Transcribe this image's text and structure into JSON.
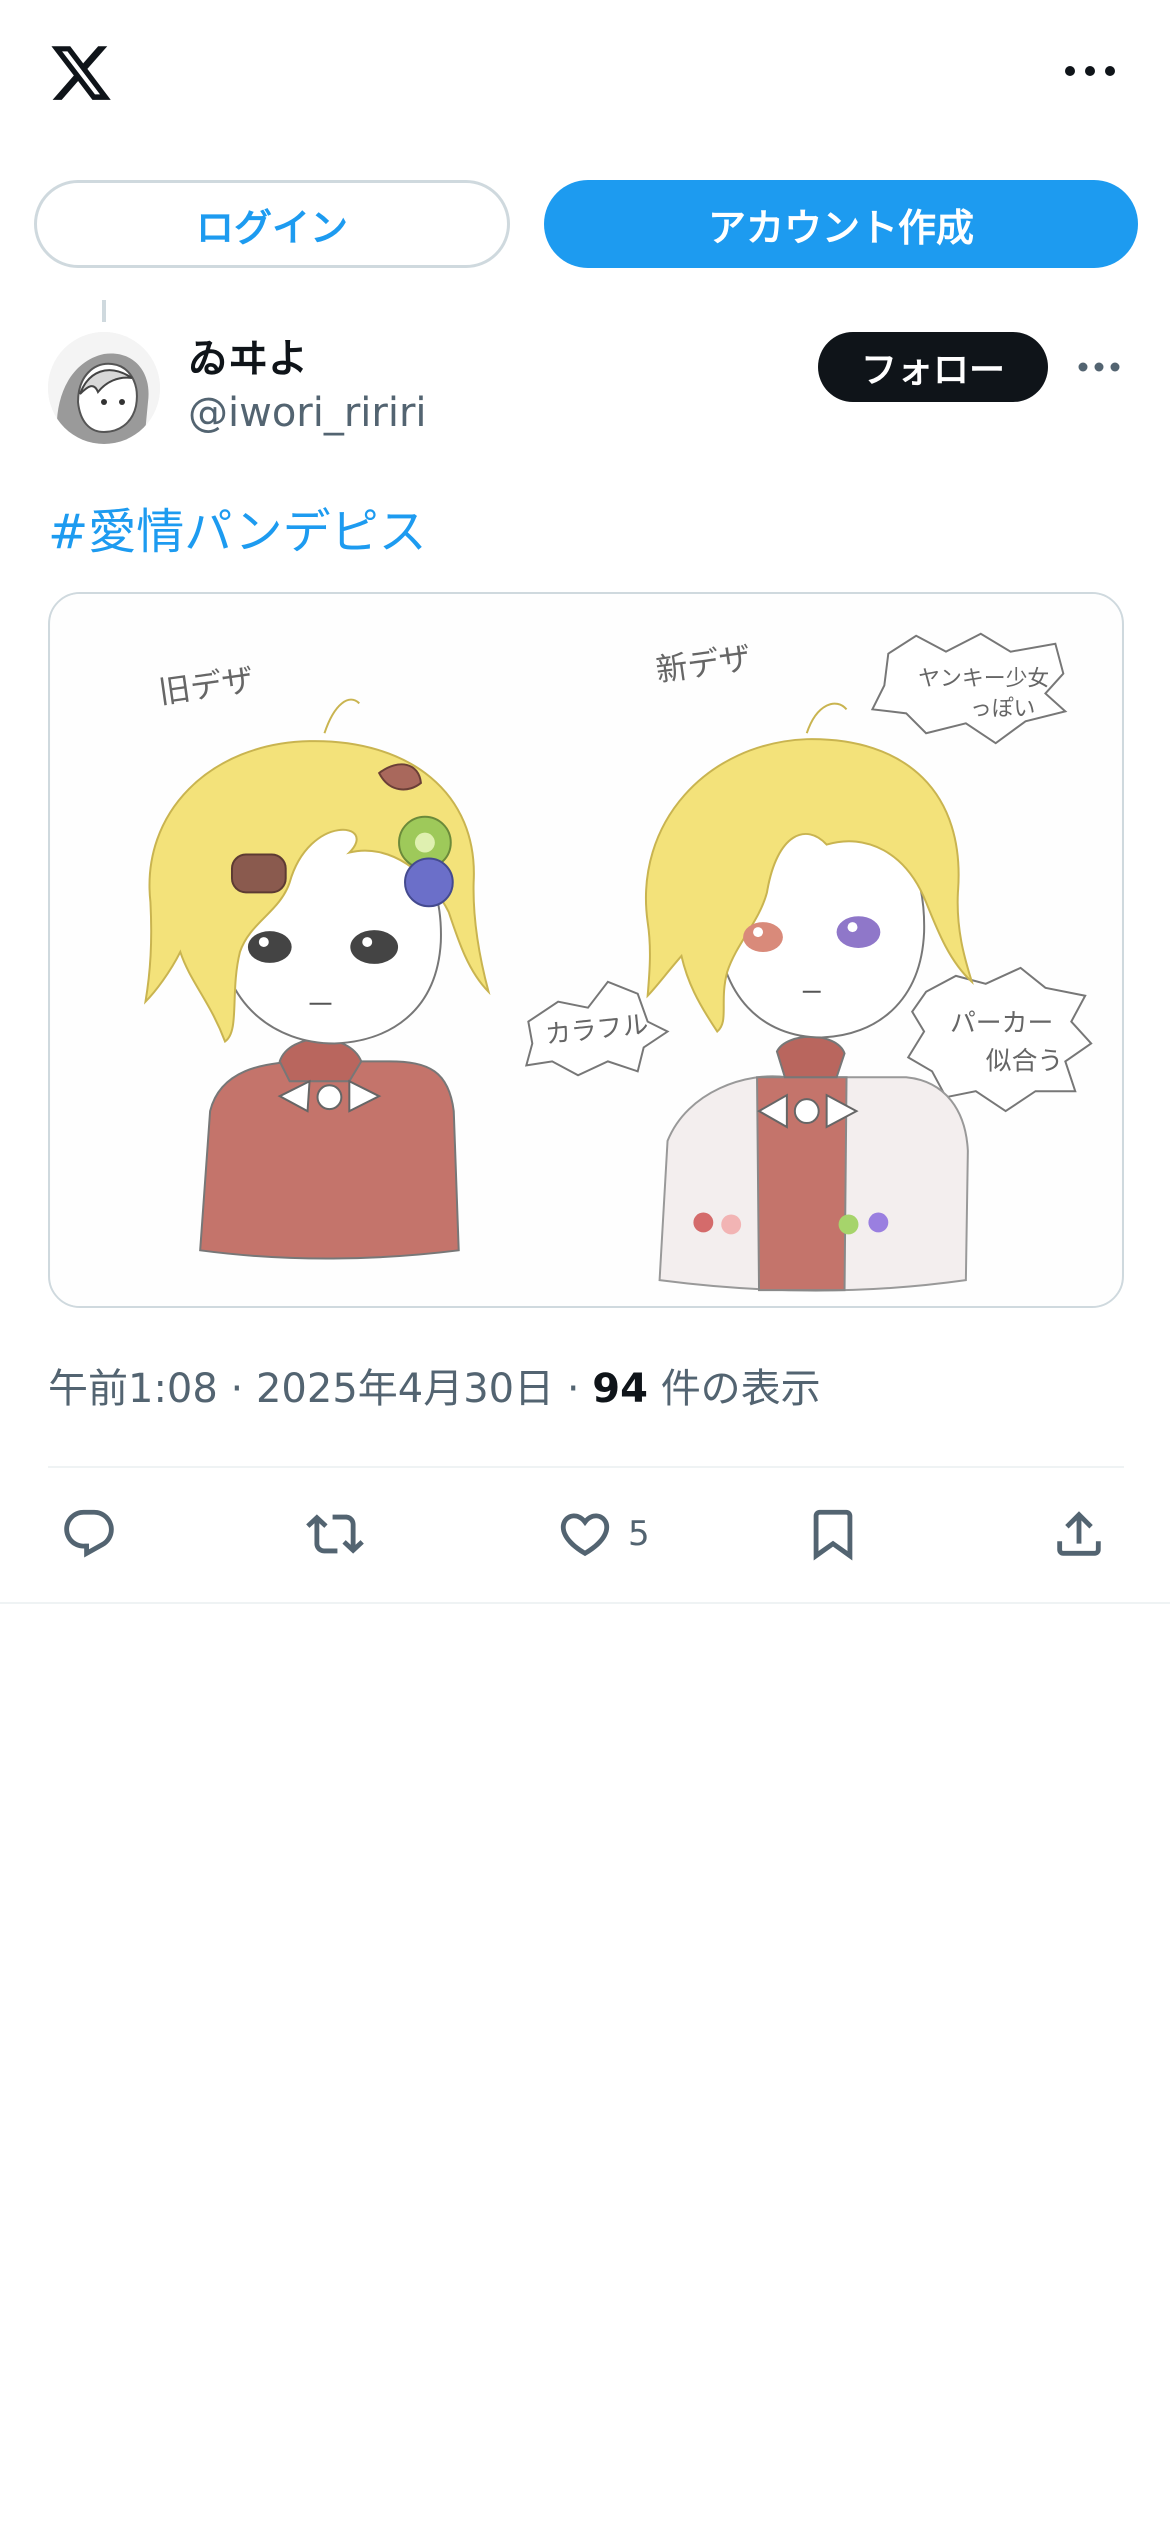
{
  "auth": {
    "login_label": "ログイン",
    "signup_label": "アカウント作成"
  },
  "post": {
    "author": {
      "display_name": "ゐヰよ",
      "handle": "@iwori_ririri"
    },
    "follow_label": "フォロー",
    "hashtag": "#愛情パンデピス",
    "image": {
      "annotations": {
        "old_design": "旧デザ",
        "new_design": "新デザ",
        "yankee_line1": "ヤンキー少女",
        "yankee_line2": "っぽい",
        "colorful": "カラフル",
        "parka_line1": "パーカー",
        "parka_line2": "似合う"
      }
    },
    "meta": {
      "time": "午前1:08",
      "separator": "·",
      "date": "2025年4月30日",
      "views_count": "94",
      "views_label": "件の表示"
    },
    "actions": {
      "like_count": "5"
    }
  },
  "colors": {
    "accent": "#1d9bf0",
    "text_primary": "#0f1419",
    "text_secondary": "#536471",
    "border": "#cfd9de"
  },
  "icons": [
    "x-logo-icon",
    "more-icon",
    "reply-icon",
    "repost-icon",
    "like-icon",
    "bookmark-icon",
    "share-icon"
  ]
}
